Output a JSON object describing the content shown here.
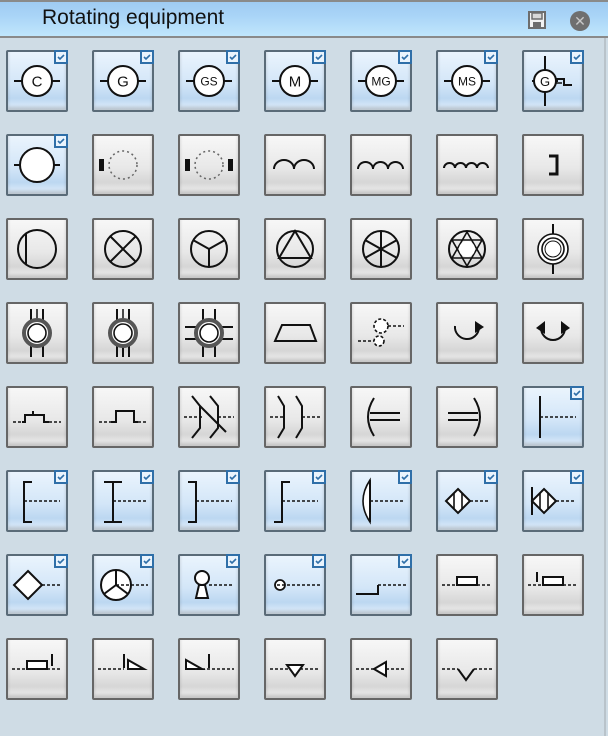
{
  "panel": {
    "title": "Rotating equipment",
    "save_icon": "floppy-disk-icon",
    "close_icon": "close-circle-icon",
    "close_glyph": "✕"
  },
  "tiles": [
    {
      "name": "compressor",
      "label": "C",
      "style": "blue",
      "checked": true
    },
    {
      "name": "generator",
      "label": "G",
      "style": "blue",
      "checked": true
    },
    {
      "name": "generator-synchronous",
      "label": "GS",
      "style": "blue",
      "checked": true
    },
    {
      "name": "motor",
      "label": "M",
      "style": "blue",
      "checked": true
    },
    {
      "name": "motor-generator",
      "label": "MG",
      "style": "blue",
      "checked": true
    },
    {
      "name": "motor-synchronous",
      "label": "MS",
      "style": "blue",
      "checked": true
    },
    {
      "name": "generator-with-connection",
      "label": "G",
      "style": "blue",
      "checked": true
    },
    {
      "name": "machine-circle",
      "label": "",
      "style": "blue",
      "checked": true
    },
    {
      "name": "machine-brush-one-side",
      "label": "",
      "style": "gray",
      "checked": false
    },
    {
      "name": "machine-brush-two-sides",
      "label": "",
      "style": "gray",
      "checked": false
    },
    {
      "name": "winding-2-loops",
      "label": "",
      "style": "gray",
      "checked": false
    },
    {
      "name": "winding-3-loops",
      "label": "",
      "style": "gray",
      "checked": false
    },
    {
      "name": "winding-4-loops",
      "label": "",
      "style": "gray",
      "checked": false
    },
    {
      "name": "bracket-end",
      "label": "",
      "style": "gray",
      "checked": false
    },
    {
      "name": "circle-with-bar",
      "label": "",
      "style": "gray",
      "checked": false
    },
    {
      "name": "circle-with-cross",
      "label": "",
      "style": "gray",
      "checked": false
    },
    {
      "name": "circle-three-phase-y",
      "label": "",
      "style": "gray",
      "checked": false
    },
    {
      "name": "circle-with-triangle",
      "label": "",
      "style": "gray",
      "checked": false
    },
    {
      "name": "circle-six-phase",
      "label": "",
      "style": "gray",
      "checked": false
    },
    {
      "name": "circle-with-star",
      "label": "",
      "style": "gray",
      "checked": false
    },
    {
      "name": "double-circle-vertical",
      "label": "",
      "style": "gray",
      "checked": false
    },
    {
      "name": "ring-two-leads",
      "label": "",
      "style": "gray",
      "checked": false
    },
    {
      "name": "ring-three-leads",
      "label": "",
      "style": "gray",
      "checked": false
    },
    {
      "name": "ring-four-leads",
      "label": "",
      "style": "gray",
      "checked": false
    },
    {
      "name": "trapezoid",
      "label": "",
      "style": "gray",
      "checked": false
    },
    {
      "name": "dashed-coupling",
      "label": "",
      "style": "gray",
      "checked": false
    },
    {
      "name": "rotation-clockwise",
      "label": "",
      "style": "gray",
      "checked": false
    },
    {
      "name": "rotation-both-directions",
      "label": "",
      "style": "gray",
      "checked": false
    },
    {
      "name": "connector-small-step",
      "label": "",
      "style": "gray",
      "checked": false
    },
    {
      "name": "connector-large-step",
      "label": "",
      "style": "gray",
      "checked": false
    },
    {
      "name": "plug-crossed",
      "label": "",
      "style": "gray",
      "checked": false
    },
    {
      "name": "plug-socket",
      "label": "",
      "style": "gray",
      "checked": false
    },
    {
      "name": "receptacle-left",
      "label": "",
      "style": "gray",
      "checked": false
    },
    {
      "name": "receptacle-right",
      "label": "",
      "style": "gray",
      "checked": false
    },
    {
      "name": "t-junction",
      "label": "",
      "style": "blue",
      "checked": true
    },
    {
      "name": "bracket-open-left",
      "label": "",
      "style": "blue",
      "checked": true
    },
    {
      "name": "i-beam",
      "label": "",
      "style": "blue",
      "checked": true
    },
    {
      "name": "bracket-close-right",
      "label": "",
      "style": "blue",
      "checked": true
    },
    {
      "name": "step-up",
      "label": "",
      "style": "blue",
      "checked": true
    },
    {
      "name": "lens-left",
      "label": "",
      "style": "blue",
      "checked": true
    },
    {
      "name": "diamond-split",
      "label": "",
      "style": "blue",
      "checked": true
    },
    {
      "name": "diamond-split-with-bar",
      "label": "",
      "style": "blue",
      "checked": true
    },
    {
      "name": "diamond",
      "label": "",
      "style": "blue",
      "checked": true
    },
    {
      "name": "circle-three-spokes",
      "label": "",
      "style": "blue",
      "checked": true
    },
    {
      "name": "keyhole",
      "label": "",
      "style": "blue",
      "checked": true
    },
    {
      "name": "small-circle-dash",
      "label": "",
      "style": "blue",
      "checked": true
    },
    {
      "name": "step-down-line",
      "label": "",
      "style": "blue",
      "checked": true
    },
    {
      "name": "rectangle-on-line",
      "label": "",
      "style": "gray",
      "checked": false
    },
    {
      "name": "rectangle-with-marker",
      "label": "",
      "style": "gray",
      "checked": false
    },
    {
      "name": "rectangle-marker-right",
      "label": "",
      "style": "gray",
      "checked": false
    },
    {
      "name": "triangle-marker-right",
      "label": "",
      "style": "gray",
      "checked": false
    },
    {
      "name": "triangle-marker-left",
      "label": "",
      "style": "gray",
      "checked": false
    },
    {
      "name": "triangle-down-on-line",
      "label": "",
      "style": "gray",
      "checked": false
    },
    {
      "name": "triangle-left-on-line",
      "label": "",
      "style": "gray",
      "checked": false
    },
    {
      "name": "v-notch-on-line",
      "label": "",
      "style": "gray",
      "checked": false
    }
  ]
}
